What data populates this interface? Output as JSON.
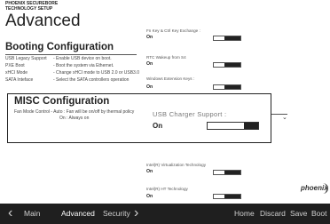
{
  "header": {
    "brand": "PHOENIX SECUREBORE\nTECHNOLOGY SETUP",
    "title": "Advanced"
  },
  "booting": {
    "title": "Booting Configuration",
    "items": [
      {
        "label": "USB Legacy Support",
        "desc": "- Enable USB device on boot."
      },
      {
        "label": "PXE Boot",
        "desc": "- Boot the system via Ethernet."
      },
      {
        "label": "xHCI Mode",
        "desc": "- Change xHCI mode to USB 2.0 or USB3.0"
      },
      {
        "label": "SATA Inteface",
        "desc": "- Select the SATA controllers operation"
      }
    ]
  },
  "right_options": [
    {
      "label": "Fn Key & Ctrl Key Exchange :",
      "value": "On"
    },
    {
      "label": "RTC Wakeup from S4",
      "value": "On"
    },
    {
      "label": "Windows Extension Keys :",
      "value": "On"
    }
  ],
  "misc": {
    "title": "MISC Configuration",
    "line1": "Fan Mode Control - Auto : Fan will be on/off by thermal policy",
    "line2": "On : Always on",
    "usb_label": "USB Charger Support :",
    "usb_value": "On"
  },
  "lower_options": [
    {
      "label": "Intel(R) Virtualization Technology",
      "value": "On"
    },
    {
      "label": "Intel(R) HT Technology",
      "value": "On"
    }
  ],
  "logo": "phoenix",
  "bottom_nav": {
    "prev_tab": "Main",
    "current_tab": "Advanced",
    "next_tab": "Security",
    "actions": [
      "Home",
      "Discard",
      "Save",
      "Boot"
    ]
  },
  "icons": {
    "chevron_left": "chevron-left-icon",
    "chevron_right": "chevron-right-icon",
    "dropdown": "chevron-down-icon"
  }
}
